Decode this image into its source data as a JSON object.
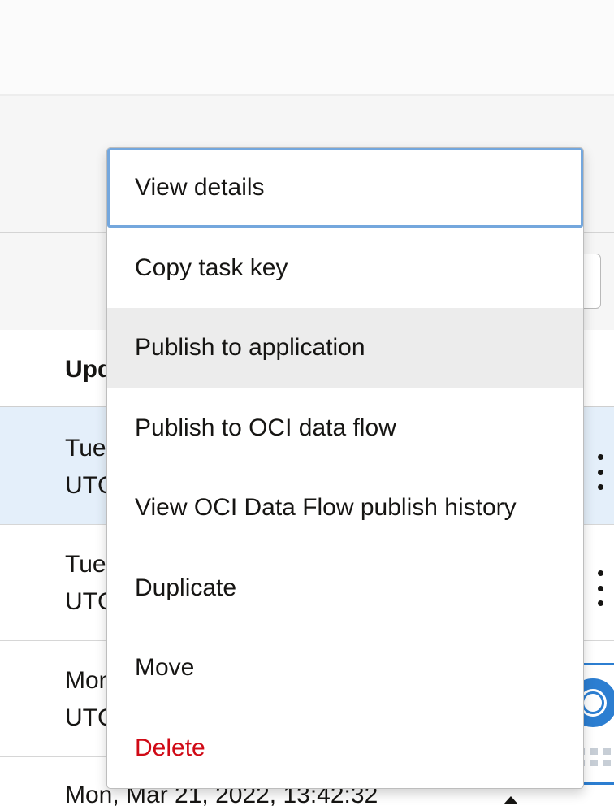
{
  "table": {
    "column_header_updated": "Upd",
    "rows": [
      {
        "line1": "Tue",
        "line2": "UTC"
      },
      {
        "line1": "Tue",
        "line2": "UTC"
      },
      {
        "line1": "Mon",
        "line2": "UTC"
      },
      {
        "line1": "Mon, Mar 21, 2022, 13:42:32"
      }
    ]
  },
  "context_menu": {
    "items": [
      {
        "label": "View details",
        "state": "focused"
      },
      {
        "label": "Copy task key"
      },
      {
        "label": "Publish to application",
        "state": "hovered"
      },
      {
        "label": "Publish to OCI data flow"
      },
      {
        "label": "View OCI Data Flow publish history"
      },
      {
        "label": "Duplicate"
      },
      {
        "label": "Move"
      },
      {
        "label": "Delete",
        "style": "danger"
      }
    ]
  },
  "help_widget": {
    "icon": "lifebuoy-icon"
  },
  "colors": {
    "accent": "#2c7ed1",
    "danger": "#d00a16",
    "selected_row": "#e4effa",
    "hover": "#ececec",
    "focus_ring": "#74a7dd"
  }
}
